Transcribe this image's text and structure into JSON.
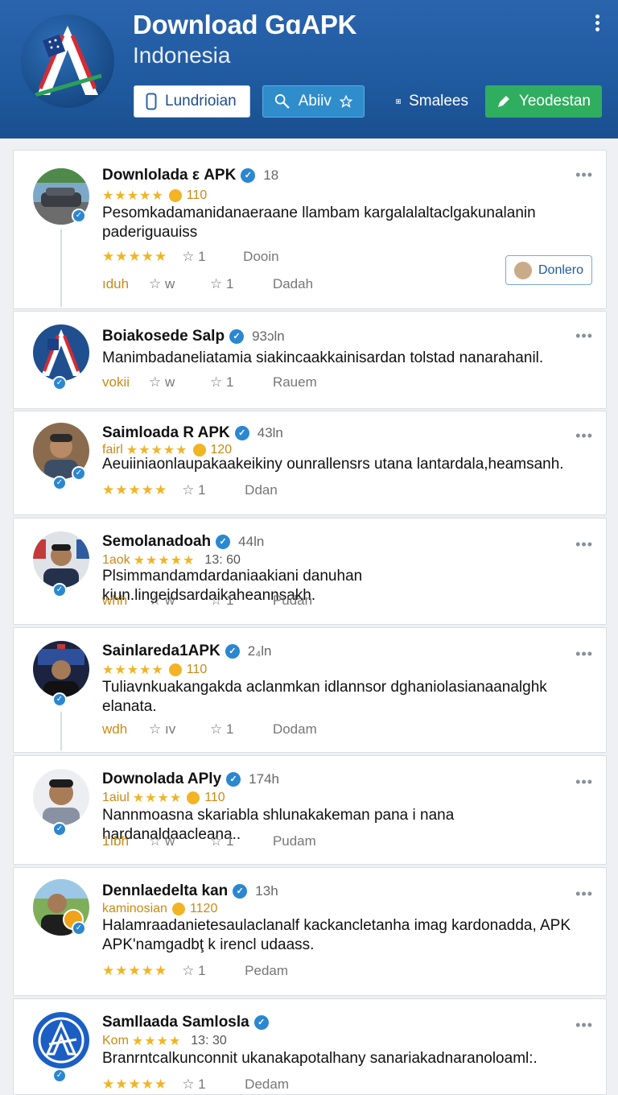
{
  "header": {
    "title_line1": "Download GɑAPK",
    "title_line2": "Indonesia",
    "buttons": [
      {
        "label": "Lundrioian",
        "icon": "phone-icon"
      },
      {
        "label": "Abiiv",
        "icon": "search-icon"
      },
      {
        "label": "Smalees",
        "icon": "square-icon"
      },
      {
        "label": "Yeodestan",
        "icon": "pencil-icon"
      }
    ],
    "colors": {
      "bar": "#2a64ad",
      "green_button": "#2fae5f",
      "blue_button": "#2f8dcc"
    }
  },
  "posts": [
    {
      "name": "Downlolada ε APK",
      "time": "18",
      "sub_stars": "★★★★★",
      "sub_text": "110",
      "body": "Pesomkadamanidanaeraane llambam kargalalaltaclgakunalanin paderiguauiss",
      "stars": "★★★★★",
      "a1": "1",
      "a2": "Dooin",
      "lead": "ıduh",
      "b1": "w",
      "b2": "1",
      "b3": "Dadah",
      "chip": "Donlero"
    },
    {
      "name": "Boiakosede Salp",
      "time": "93ɔln",
      "body": "Manimbadaneliatamia siakincaakkainisardan tolstad nanarahanil.",
      "lead": "vokii",
      "b1": "w",
      "b2": "1",
      "b3": "Rauem"
    },
    {
      "name": "Saimloada R APK",
      "time": "43ln",
      "sub_lead": "fairl",
      "sub_stars": "★★★★★",
      "sub_text": "120",
      "body": "Aeuiiniaonlaupakaakeikiny ounrallensrs utana lantardala,heamsanh.",
      "stars": "★★★★★",
      "b2": "1",
      "b3": "Ddan"
    },
    {
      "name": "Semolanadoah",
      "time": "44ln",
      "sub_lead": "1aok",
      "sub_stars": "★★★★★",
      "sub_text": "13: 60",
      "body": "Plsimmandamdardaniaakiani danuhan kiun.lingeidsardaikaheannsakh.",
      "lead": "whh",
      "b1": "w",
      "b2": "1",
      "b3": "Pudan"
    },
    {
      "name": "Sainlareda1APK",
      "time": "2₄ln",
      "sub_stars": "★★★★★",
      "sub_text": "110",
      "body": "Tuliavnkuakangakda aclanmkan idlannsor dghaniolasianaanalghk elanata.",
      "lead": "wdh",
      "b1": "ıv",
      "b2": "1",
      "b3": "Dodam"
    },
    {
      "name": "Downolada APly",
      "time": "174h",
      "sub_lead": "1aiul",
      "sub_stars": "★★★★",
      "sub_text": "110",
      "body": "Nannmoasna skariabla shlunakakeman pana i nana hardanaldaacleana..",
      "lead": "1ıbh",
      "b1": "w",
      "b2": "1",
      "b3": "Pudam"
    },
    {
      "name": "Dennlaedelta kan",
      "time": "13h",
      "sub_lead": "kaminosian",
      "sub_text": "1120",
      "body": "Halamraadanietesaulaclanalf kackancletanha imag kardonadda, APK APK'namgadbţ k irencl udaass.",
      "stars": "★★★★★",
      "b2": "1",
      "b3": "Pedam"
    },
    {
      "name": "Samllaada Samlosla",
      "time": "",
      "sub_lead": "Kom",
      "sub_stars": "★★★★",
      "sub_text": "13: 30",
      "body": "Branrntcalkunconnit ukanakapotalhany sanariakadnaranoloaml:.",
      "stars": "★★★★★",
      "b2": "1",
      "b3": "Dedam"
    }
  ],
  "icons": {
    "more": "more-horizontal-icon",
    "verified": "verified-check-icon",
    "star": "star-outline-icon",
    "menu": "kebab-menu-icon"
  }
}
